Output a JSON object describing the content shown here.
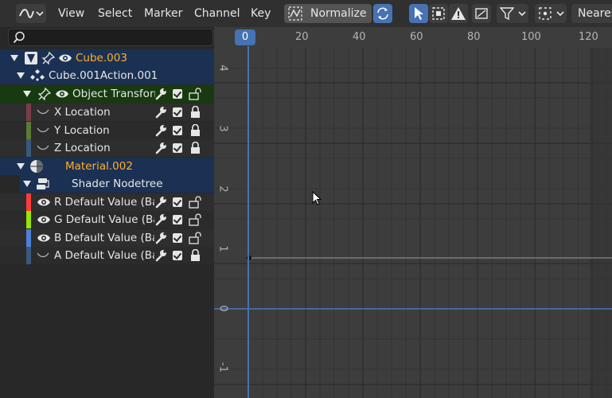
{
  "header": {
    "menu": [
      "View",
      "Select",
      "Marker",
      "Channel",
      "Key"
    ],
    "normalize_label": "Normalize",
    "interp_label": "Neares"
  },
  "search": {
    "placeholder": ""
  },
  "channels": [
    {
      "label": "Cube.003",
      "type": "object",
      "color": "#ffaf29"
    },
    {
      "label": "Cube.001Action.001",
      "type": "action"
    },
    {
      "label": "Object Transforms",
      "type": "group"
    },
    {
      "label": "X Location",
      "type": "fcurve",
      "bar": "#7a3d48"
    },
    {
      "label": "Y Location",
      "type": "fcurve",
      "bar": "#5b7a33"
    },
    {
      "label": "Z Location",
      "type": "fcurve",
      "bar": "#38587e"
    },
    {
      "label": "Material.002",
      "type": "material",
      "color": "#ffaf29"
    },
    {
      "label": "Shader Nodetree",
      "type": "nodetree"
    },
    {
      "label": "R Default Value (Base",
      "type": "fcurve",
      "bar": "#ff3b3b"
    },
    {
      "label": "G Default Value (Base",
      "type": "fcurve",
      "bar": "#96e600"
    },
    {
      "label": "B Default Value (Base",
      "type": "fcurve",
      "bar": "#4f7fd9"
    },
    {
      "label": "A Default Value (Base",
      "type": "fcurve",
      "bar": "#38587e"
    }
  ],
  "graph": {
    "current_frame": "0",
    "x_ticks": [
      "20",
      "40",
      "60",
      "80",
      "100",
      "120"
    ],
    "y_ticks": [
      "4",
      "3",
      "2",
      "1",
      "0",
      "-1"
    ]
  },
  "colors": {
    "accent": "#4772b3",
    "object_text": "#ffaf29"
  }
}
